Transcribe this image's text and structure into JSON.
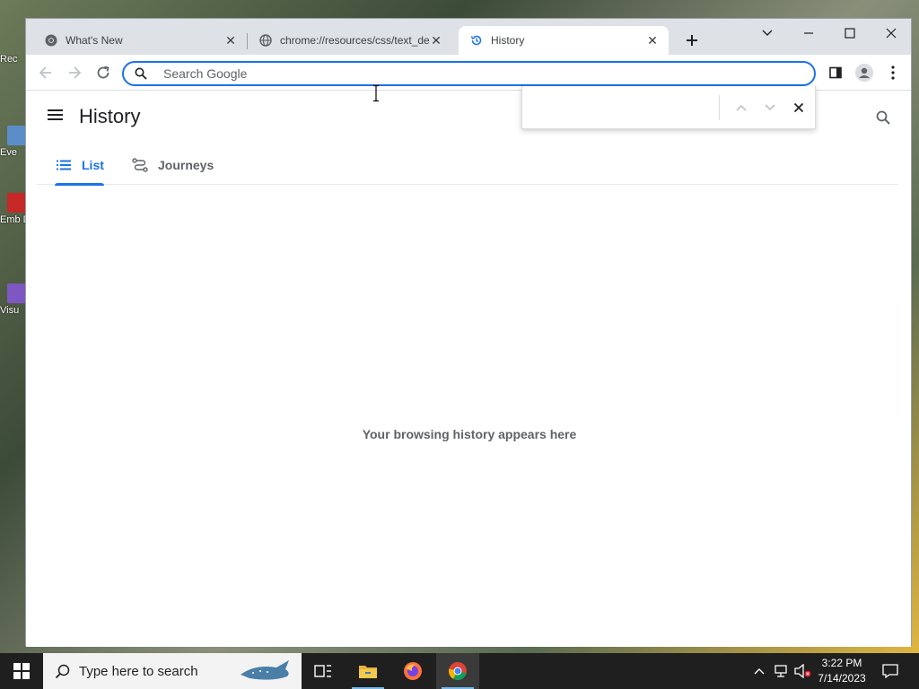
{
  "tabs": [
    {
      "title": "What's New",
      "icon": "chrome-icon"
    },
    {
      "title": "chrome://resources/css/text_defaults",
      "icon": "globe-icon"
    },
    {
      "title": "History",
      "icon": "history-icon"
    }
  ],
  "omnibox": {
    "placeholder": "Search Google",
    "value": ""
  },
  "page": {
    "title": "History",
    "tabs": [
      {
        "label": "List",
        "icon": "list-icon"
      },
      {
        "label": "Journeys",
        "icon": "journeys-icon"
      }
    ],
    "empty_message": "Your browsing history appears here"
  },
  "findbar": {
    "value": ""
  },
  "desktop_icons": [
    {
      "label": "Rec"
    },
    {
      "label": "Eve"
    },
    {
      "label": "Emb De"
    },
    {
      "label": "Visu"
    }
  ],
  "taskbar": {
    "search_placeholder": "Type here to search",
    "time": "3:22 PM",
    "date": "7/14/2023"
  },
  "colors": {
    "accent": "#1a73e8",
    "tabstrip": "#dee1e6",
    "taskbar": "#1f1f1f"
  }
}
